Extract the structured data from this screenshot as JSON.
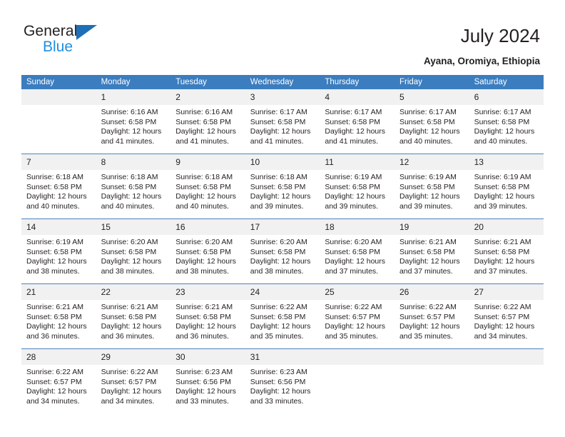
{
  "brand": {
    "name_dark": "General",
    "name_light": "Blue",
    "triangle_color": "#1e6fb8",
    "light_color": "#1f8fe0"
  },
  "header": {
    "title": "July 2024",
    "location": "Ayana, Oromiya, Ethiopia"
  },
  "theme": {
    "header_bg": "#3b7dbf",
    "daynum_bg": "#f1f1f1",
    "row_line": "#4a84c0",
    "text": "#231f20"
  },
  "weekday_headers": [
    "Sunday",
    "Monday",
    "Tuesday",
    "Wednesday",
    "Thursday",
    "Friday",
    "Saturday"
  ],
  "weeks": [
    [
      {
        "day": "",
        "sunrise": "",
        "sunset": "",
        "daylight_line1": "",
        "daylight_line2": ""
      },
      {
        "day": "1",
        "sunrise": "Sunrise: 6:16 AM",
        "sunset": "Sunset: 6:58 PM",
        "daylight_line1": "Daylight: 12 hours",
        "daylight_line2": "and 41 minutes."
      },
      {
        "day": "2",
        "sunrise": "Sunrise: 6:16 AM",
        "sunset": "Sunset: 6:58 PM",
        "daylight_line1": "Daylight: 12 hours",
        "daylight_line2": "and 41 minutes."
      },
      {
        "day": "3",
        "sunrise": "Sunrise: 6:17 AM",
        "sunset": "Sunset: 6:58 PM",
        "daylight_line1": "Daylight: 12 hours",
        "daylight_line2": "and 41 minutes."
      },
      {
        "day": "4",
        "sunrise": "Sunrise: 6:17 AM",
        "sunset": "Sunset: 6:58 PM",
        "daylight_line1": "Daylight: 12 hours",
        "daylight_line2": "and 41 minutes."
      },
      {
        "day": "5",
        "sunrise": "Sunrise: 6:17 AM",
        "sunset": "Sunset: 6:58 PM",
        "daylight_line1": "Daylight: 12 hours",
        "daylight_line2": "and 40 minutes."
      },
      {
        "day": "6",
        "sunrise": "Sunrise: 6:17 AM",
        "sunset": "Sunset: 6:58 PM",
        "daylight_line1": "Daylight: 12 hours",
        "daylight_line2": "and 40 minutes."
      }
    ],
    [
      {
        "day": "7",
        "sunrise": "Sunrise: 6:18 AM",
        "sunset": "Sunset: 6:58 PM",
        "daylight_line1": "Daylight: 12 hours",
        "daylight_line2": "and 40 minutes."
      },
      {
        "day": "8",
        "sunrise": "Sunrise: 6:18 AM",
        "sunset": "Sunset: 6:58 PM",
        "daylight_line1": "Daylight: 12 hours",
        "daylight_line2": "and 40 minutes."
      },
      {
        "day": "9",
        "sunrise": "Sunrise: 6:18 AM",
        "sunset": "Sunset: 6:58 PM",
        "daylight_line1": "Daylight: 12 hours",
        "daylight_line2": "and 40 minutes."
      },
      {
        "day": "10",
        "sunrise": "Sunrise: 6:18 AM",
        "sunset": "Sunset: 6:58 PM",
        "daylight_line1": "Daylight: 12 hours",
        "daylight_line2": "and 39 minutes."
      },
      {
        "day": "11",
        "sunrise": "Sunrise: 6:19 AM",
        "sunset": "Sunset: 6:58 PM",
        "daylight_line1": "Daylight: 12 hours",
        "daylight_line2": "and 39 minutes."
      },
      {
        "day": "12",
        "sunrise": "Sunrise: 6:19 AM",
        "sunset": "Sunset: 6:58 PM",
        "daylight_line1": "Daylight: 12 hours",
        "daylight_line2": "and 39 minutes."
      },
      {
        "day": "13",
        "sunrise": "Sunrise: 6:19 AM",
        "sunset": "Sunset: 6:58 PM",
        "daylight_line1": "Daylight: 12 hours",
        "daylight_line2": "and 39 minutes."
      }
    ],
    [
      {
        "day": "14",
        "sunrise": "Sunrise: 6:19 AM",
        "sunset": "Sunset: 6:58 PM",
        "daylight_line1": "Daylight: 12 hours",
        "daylight_line2": "and 38 minutes."
      },
      {
        "day": "15",
        "sunrise": "Sunrise: 6:20 AM",
        "sunset": "Sunset: 6:58 PM",
        "daylight_line1": "Daylight: 12 hours",
        "daylight_line2": "and 38 minutes."
      },
      {
        "day": "16",
        "sunrise": "Sunrise: 6:20 AM",
        "sunset": "Sunset: 6:58 PM",
        "daylight_line1": "Daylight: 12 hours",
        "daylight_line2": "and 38 minutes."
      },
      {
        "day": "17",
        "sunrise": "Sunrise: 6:20 AM",
        "sunset": "Sunset: 6:58 PM",
        "daylight_line1": "Daylight: 12 hours",
        "daylight_line2": "and 38 minutes."
      },
      {
        "day": "18",
        "sunrise": "Sunrise: 6:20 AM",
        "sunset": "Sunset: 6:58 PM",
        "daylight_line1": "Daylight: 12 hours",
        "daylight_line2": "and 37 minutes."
      },
      {
        "day": "19",
        "sunrise": "Sunrise: 6:21 AM",
        "sunset": "Sunset: 6:58 PM",
        "daylight_line1": "Daylight: 12 hours",
        "daylight_line2": "and 37 minutes."
      },
      {
        "day": "20",
        "sunrise": "Sunrise: 6:21 AM",
        "sunset": "Sunset: 6:58 PM",
        "daylight_line1": "Daylight: 12 hours",
        "daylight_line2": "and 37 minutes."
      }
    ],
    [
      {
        "day": "21",
        "sunrise": "Sunrise: 6:21 AM",
        "sunset": "Sunset: 6:58 PM",
        "daylight_line1": "Daylight: 12 hours",
        "daylight_line2": "and 36 minutes."
      },
      {
        "day": "22",
        "sunrise": "Sunrise: 6:21 AM",
        "sunset": "Sunset: 6:58 PM",
        "daylight_line1": "Daylight: 12 hours",
        "daylight_line2": "and 36 minutes."
      },
      {
        "day": "23",
        "sunrise": "Sunrise: 6:21 AM",
        "sunset": "Sunset: 6:58 PM",
        "daylight_line1": "Daylight: 12 hours",
        "daylight_line2": "and 36 minutes."
      },
      {
        "day": "24",
        "sunrise": "Sunrise: 6:22 AM",
        "sunset": "Sunset: 6:58 PM",
        "daylight_line1": "Daylight: 12 hours",
        "daylight_line2": "and 35 minutes."
      },
      {
        "day": "25",
        "sunrise": "Sunrise: 6:22 AM",
        "sunset": "Sunset: 6:57 PM",
        "daylight_line1": "Daylight: 12 hours",
        "daylight_line2": "and 35 minutes."
      },
      {
        "day": "26",
        "sunrise": "Sunrise: 6:22 AM",
        "sunset": "Sunset: 6:57 PM",
        "daylight_line1": "Daylight: 12 hours",
        "daylight_line2": "and 35 minutes."
      },
      {
        "day": "27",
        "sunrise": "Sunrise: 6:22 AM",
        "sunset": "Sunset: 6:57 PM",
        "daylight_line1": "Daylight: 12 hours",
        "daylight_line2": "and 34 minutes."
      }
    ],
    [
      {
        "day": "28",
        "sunrise": "Sunrise: 6:22 AM",
        "sunset": "Sunset: 6:57 PM",
        "daylight_line1": "Daylight: 12 hours",
        "daylight_line2": "and 34 minutes."
      },
      {
        "day": "29",
        "sunrise": "Sunrise: 6:22 AM",
        "sunset": "Sunset: 6:57 PM",
        "daylight_line1": "Daylight: 12 hours",
        "daylight_line2": "and 34 minutes."
      },
      {
        "day": "30",
        "sunrise": "Sunrise: 6:23 AM",
        "sunset": "Sunset: 6:56 PM",
        "daylight_line1": "Daylight: 12 hours",
        "daylight_line2": "and 33 minutes."
      },
      {
        "day": "31",
        "sunrise": "Sunrise: 6:23 AM",
        "sunset": "Sunset: 6:56 PM",
        "daylight_line1": "Daylight: 12 hours",
        "daylight_line2": "and 33 minutes."
      },
      {
        "day": "",
        "sunrise": "",
        "sunset": "",
        "daylight_line1": "",
        "daylight_line2": ""
      },
      {
        "day": "",
        "sunrise": "",
        "sunset": "",
        "daylight_line1": "",
        "daylight_line2": ""
      },
      {
        "day": "",
        "sunrise": "",
        "sunset": "",
        "daylight_line1": "",
        "daylight_line2": ""
      }
    ]
  ]
}
